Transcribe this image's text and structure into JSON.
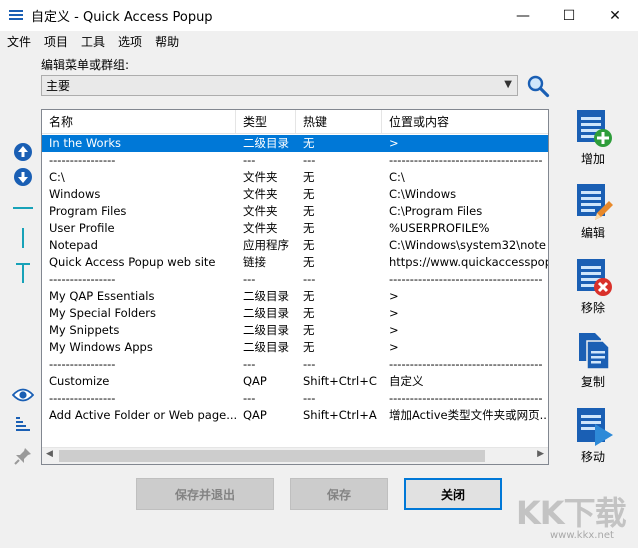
{
  "window": {
    "title": "自定义 - Quick Access Popup",
    "minimize_glyph": "—",
    "maximize_glyph": "☐",
    "close_glyph": "✕"
  },
  "menu": [
    "文件",
    "项目",
    "工具",
    "选项",
    "帮助"
  ],
  "edit_label": "编辑菜单或群组:",
  "combo": {
    "selected": "主要"
  },
  "columns": [
    "名称",
    "类型",
    "热键",
    "位置或内容"
  ],
  "rows": [
    {
      "name": "In the Works",
      "type": "二级目录",
      "hotkey": "无",
      "location": ">",
      "selected": true
    },
    {
      "name": "----------------",
      "type": "---",
      "hotkey": "---",
      "location": "-------------------------------------"
    },
    {
      "name": "C:\\",
      "type": "文件夹",
      "hotkey": "无",
      "location": "C:\\"
    },
    {
      "name": "Windows",
      "type": "文件夹",
      "hotkey": "无",
      "location": "C:\\Windows"
    },
    {
      "name": "Program Files",
      "type": "文件夹",
      "hotkey": "无",
      "location": "C:\\Program Files"
    },
    {
      "name": "User Profile",
      "type": "文件夹",
      "hotkey": "无",
      "location": "%USERPROFILE%"
    },
    {
      "name": "Notepad",
      "type": "应用程序",
      "hotkey": "无",
      "location": "C:\\Windows\\system32\\note"
    },
    {
      "name": "Quick Access Popup web site",
      "type": "链接",
      "hotkey": "无",
      "location": "https://www.quickaccesspop"
    },
    {
      "name": "----------------",
      "type": "---",
      "hotkey": "---",
      "location": "-------------------------------------"
    },
    {
      "name": "My QAP Essentials",
      "type": "二级目录",
      "hotkey": "无",
      "location": ">"
    },
    {
      "name": "My Special Folders",
      "type": "二级目录",
      "hotkey": "无",
      "location": ">"
    },
    {
      "name": "My Snippets",
      "type": "二级目录",
      "hotkey": "无",
      "location": ">"
    },
    {
      "name": "My Windows Apps",
      "type": "二级目录",
      "hotkey": "无",
      "location": ">"
    },
    {
      "name": "----------------",
      "type": "---",
      "hotkey": "---",
      "location": "-------------------------------------"
    },
    {
      "name": "Customize",
      "type": "QAP",
      "hotkey": "Shift+Ctrl+C",
      "location": "自定义"
    },
    {
      "name": "----------------",
      "type": "---",
      "hotkey": "---",
      "location": "-------------------------------------"
    },
    {
      "name": "Add Active Folder or Web page...",
      "type": "QAP",
      "hotkey": "Shift+Ctrl+A",
      "location": "增加Active类型文件夹或网页..."
    }
  ],
  "right_buttons": [
    {
      "label": "增加",
      "icon": "add-icon"
    },
    {
      "label": "编辑",
      "icon": "edit-icon"
    },
    {
      "label": "移除",
      "icon": "remove-icon"
    },
    {
      "label": "复制",
      "icon": "copy-icon"
    },
    {
      "label": "移动",
      "icon": "move-icon"
    }
  ],
  "bottom_buttons": {
    "save_exit": "保存并退出",
    "save": "保存",
    "close": "关闭"
  },
  "watermark": {
    "main": "KK下载",
    "sub": "www.kkx.net"
  },
  "colors": {
    "selection": "#0078d7",
    "accent_blue": "#1a5fb4",
    "add_green": "#2e9d3a",
    "remove_red": "#d9312b",
    "edit_orange": "#e8892b"
  }
}
